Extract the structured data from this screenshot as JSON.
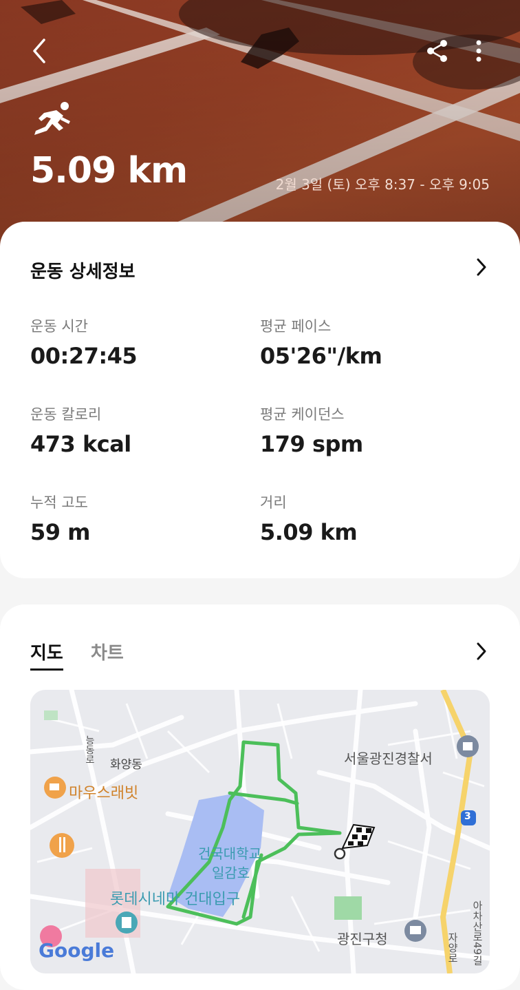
{
  "header": {
    "distance": "5.09 km",
    "datetime": "2월 3일 (토) 오후 8:37 - 오후 9:05",
    "icons": [
      "back-icon",
      "share-icon",
      "more-icon",
      "running-icon"
    ]
  },
  "details": {
    "title": "운동 상세정보",
    "stats": [
      {
        "label": "운동 시간",
        "value": "00:27:45"
      },
      {
        "label": "평균 페이스",
        "value": "05'26\"/km"
      },
      {
        "label": "운동 칼로리",
        "value": "473 kcal"
      },
      {
        "label": "평균 케이던스",
        "value": "179 spm"
      },
      {
        "label": "누적 고도",
        "value": "59 m"
      },
      {
        "label": "거리",
        "value": "5.09 km"
      }
    ]
  },
  "map_section": {
    "tabs": [
      "지도",
      "차트"
    ],
    "labels": {
      "hwayang": "화양동",
      "mouse_rabbit": "마우스래빗",
      "police": "서울광진경찰서",
      "lake1": "건국대학교",
      "lake2": "일감호",
      "cinema": "롯데시네마 건대입구",
      "office": "광진구청",
      "road_badge": "3",
      "road_jayang": "자양로",
      "road_achasan": "아차산로49길",
      "road_left": "능동로",
      "google": "Google"
    },
    "colors": {
      "route": "#4cbf5a",
      "lake": "#a9bdf3",
      "road_yellow": "#f6d36b"
    }
  }
}
